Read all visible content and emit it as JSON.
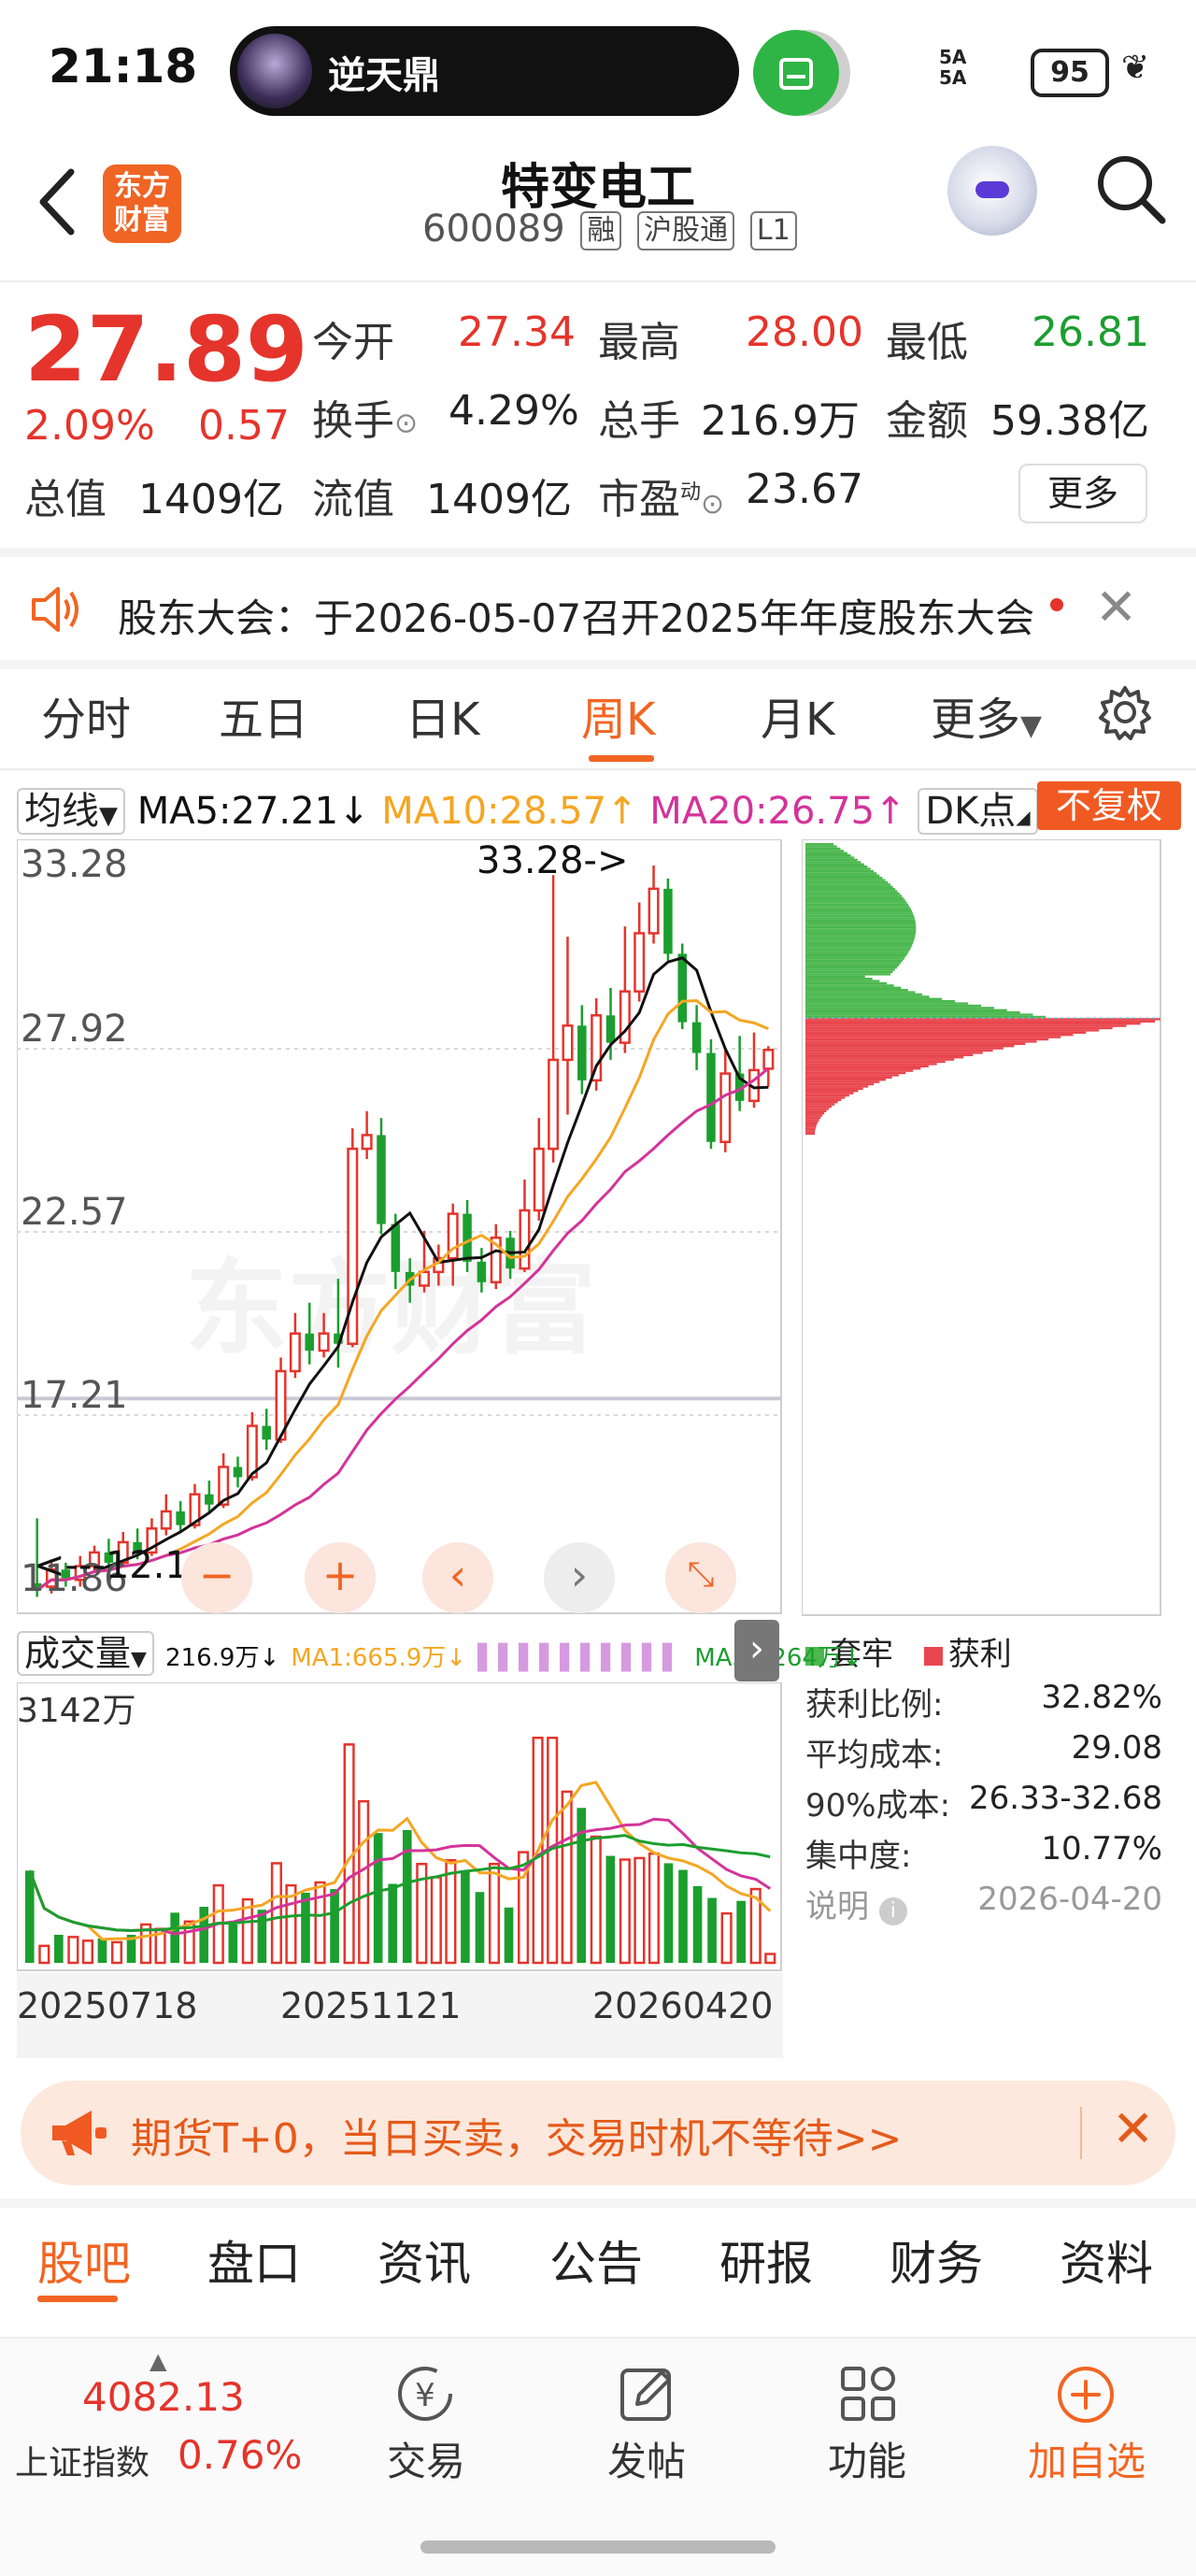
{
  "status_bar": {
    "time": "21:18",
    "pill_title": "逆天鼎",
    "signal_top": "5A",
    "signal_bottom": "5A",
    "battery": "95"
  },
  "header": {
    "logo_line1": "东方",
    "logo_line2": "财富",
    "stock_name": "特变电工",
    "stock_code": "600089",
    "tags": [
      "融",
      "沪股通",
      "L1"
    ]
  },
  "quote": {
    "price": "27.89",
    "change_pct": "2.09%",
    "change": "0.57",
    "open_label": "今开",
    "open": "27.34",
    "high_label": "最高",
    "high": "28.00",
    "low_label": "最低",
    "low": "26.81",
    "turnover_label": "换手",
    "turnover": "4.29%",
    "volume_label": "总手",
    "volume": "216.9万",
    "amount_label": "金额",
    "amount": "59.38亿",
    "total_mv_label": "总值",
    "total_mv": "1409亿",
    "float_mv_label": "流值",
    "float_mv": "1409亿",
    "pe_label": "市盈",
    "pe_sup": "动",
    "pe": "23.67",
    "more_label": "更多"
  },
  "notice": {
    "text": "股东大会：于2026-05-07召开2025年年度股东大会"
  },
  "period_tabs": [
    "分时",
    "五日",
    "日K",
    "周K",
    "月K",
    "更多"
  ],
  "active_tab": "周K",
  "ma_row": {
    "selector": "均线",
    "ma5": "MA5:27.21",
    "ma5_arrow": "↓",
    "ma10": "MA10:28.57",
    "ma10_arrow": "↑",
    "ma20": "MA20:26.75",
    "ma20_arrow": "↑",
    "dk": "DK点",
    "adjust": "不复权"
  },
  "colors": {
    "up": "#e5342b",
    "down": "#1c9e2f",
    "ma5": "#111111",
    "ma10": "#f5a623",
    "ma20": "#d4339a",
    "accent": "#f26522"
  },
  "kline": {
    "y_labels": [
      "33.28",
      "27.92",
      "22.57",
      "17.21",
      "11.86"
    ],
    "high_annotation": "33.28->",
    "low_annotation": "<---12.10"
  },
  "chart_data": {
    "type": "candlestick",
    "title": "",
    "period": "weekly",
    "ylim": [
      11.86,
      33.28
    ],
    "ylabels": [
      "33.28",
      "27.92",
      "22.57",
      "17.21",
      "11.86"
    ],
    "x_labels": [
      "20250718",
      "20251121",
      "20260420"
    ],
    "candles": [
      {
        "o": 12.3,
        "c": 12.1,
        "h": 14.2,
        "l": 11.9
      },
      {
        "o": 12.2,
        "c": 12.7,
        "h": 13.0,
        "l": 12.0
      },
      {
        "o": 12.7,
        "c": 12.4,
        "h": 12.9,
        "l": 12.2
      },
      {
        "o": 12.4,
        "c": 12.8,
        "h": 13.1,
        "l": 12.2
      },
      {
        "o": 12.8,
        "c": 13.2,
        "h": 13.4,
        "l": 12.6
      },
      {
        "o": 13.2,
        "c": 12.9,
        "h": 13.6,
        "l": 12.7
      },
      {
        "o": 12.9,
        "c": 13.5,
        "h": 13.8,
        "l": 12.8
      },
      {
        "o": 13.5,
        "c": 13.2,
        "h": 13.9,
        "l": 13.0
      },
      {
        "o": 13.2,
        "c": 13.9,
        "h": 14.2,
        "l": 13.1
      },
      {
        "o": 13.9,
        "c": 14.4,
        "h": 14.9,
        "l": 13.7
      },
      {
        "o": 14.4,
        "c": 14.0,
        "h": 14.7,
        "l": 13.8
      },
      {
        "o": 14.0,
        "c": 14.9,
        "h": 15.2,
        "l": 13.9
      },
      {
        "o": 14.9,
        "c": 14.6,
        "h": 15.3,
        "l": 14.4
      },
      {
        "o": 14.6,
        "c": 15.7,
        "h": 16.1,
        "l": 14.5
      },
      {
        "o": 15.7,
        "c": 15.4,
        "h": 16.0,
        "l": 15.1
      },
      {
        "o": 15.4,
        "c": 16.9,
        "h": 17.3,
        "l": 15.3
      },
      {
        "o": 16.9,
        "c": 16.5,
        "h": 17.4,
        "l": 16.2
      },
      {
        "o": 16.5,
        "c": 18.5,
        "h": 18.9,
        "l": 16.4
      },
      {
        "o": 18.5,
        "c": 19.6,
        "h": 20.2,
        "l": 18.3
      },
      {
        "o": 19.6,
        "c": 19.1,
        "h": 20.5,
        "l": 18.7
      },
      {
        "o": 19.1,
        "c": 19.6,
        "h": 20.2,
        "l": 18.9
      },
      {
        "o": 19.6,
        "c": 19.3,
        "h": 21.2,
        "l": 18.6
      },
      {
        "o": 19.3,
        "c": 25.0,
        "h": 25.6,
        "l": 19.2
      },
      {
        "o": 25.0,
        "c": 25.4,
        "h": 26.1,
        "l": 24.7
      },
      {
        "o": 25.4,
        "c": 22.8,
        "h": 25.9,
        "l": 22.5
      },
      {
        "o": 22.8,
        "c": 21.4,
        "h": 23.1,
        "l": 20.9
      },
      {
        "o": 21.4,
        "c": 21.0,
        "h": 21.8,
        "l": 20.5
      },
      {
        "o": 21.0,
        "c": 21.4,
        "h": 22.6,
        "l": 20.8
      },
      {
        "o": 21.4,
        "c": 21.8,
        "h": 22.2,
        "l": 21.0
      },
      {
        "o": 21.8,
        "c": 23.1,
        "h": 23.4,
        "l": 21.0
      },
      {
        "o": 23.1,
        "c": 21.7,
        "h": 23.5,
        "l": 21.4
      },
      {
        "o": 21.7,
        "c": 21.1,
        "h": 22.1,
        "l": 20.8
      },
      {
        "o": 21.1,
        "c": 22.4,
        "h": 22.8,
        "l": 20.9
      },
      {
        "o": 22.4,
        "c": 21.5,
        "h": 22.6,
        "l": 21.2
      },
      {
        "o": 21.5,
        "c": 23.2,
        "h": 24.1,
        "l": 21.4
      },
      {
        "o": 23.2,
        "c": 25.0,
        "h": 25.9,
        "l": 22.9
      },
      {
        "o": 25.0,
        "c": 27.6,
        "h": 33.0,
        "l": 24.6
      },
      {
        "o": 27.6,
        "c": 28.6,
        "h": 31.2,
        "l": 26.0
      },
      {
        "o": 28.6,
        "c": 27.0,
        "h": 29.2,
        "l": 26.6
      },
      {
        "o": 27.0,
        "c": 28.9,
        "h": 29.4,
        "l": 26.7
      },
      {
        "o": 28.9,
        "c": 28.1,
        "h": 29.7,
        "l": 27.6
      },
      {
        "o": 28.1,
        "c": 29.6,
        "h": 31.5,
        "l": 27.8
      },
      {
        "o": 29.6,
        "c": 31.3,
        "h": 32.2,
        "l": 29.3
      },
      {
        "o": 31.3,
        "c": 32.6,
        "h": 33.28,
        "l": 31.0
      },
      {
        "o": 32.6,
        "c": 30.7,
        "h": 32.9,
        "l": 30.5
      },
      {
        "o": 30.7,
        "c": 28.7,
        "h": 31.0,
        "l": 28.5
      },
      {
        "o": 28.7,
        "c": 27.8,
        "h": 29.2,
        "l": 27.3
      },
      {
        "o": 27.8,
        "c": 25.2,
        "h": 28.2,
        "l": 25.0
      },
      {
        "o": 25.2,
        "c": 27.2,
        "h": 27.9,
        "l": 24.9
      },
      {
        "o": 27.2,
        "c": 26.4,
        "h": 28.3,
        "l": 26.1
      },
      {
        "o": 26.4,
        "c": 27.3,
        "h": 28.4,
        "l": 26.2
      },
      {
        "o": 27.34,
        "c": 27.89,
        "h": 28.0,
        "l": 26.81
      }
    ],
    "volume": {
      "ylabel_max": "3142万",
      "ylim": [
        0,
        3142
      ],
      "values": [
        1250,
        230,
        380,
        350,
        300,
        330,
        280,
        380,
        520,
        460,
        680,
        560,
        760,
        1050,
        520,
        860,
        720,
        1350,
        1050,
        950,
        1090,
        1000,
        2960,
        2190,
        1760,
        1070,
        1800,
        1340,
        1160,
        1390,
        1250,
        960,
        1340,
        750,
        1500,
        3050,
        3050,
        2320,
        2100,
        1710,
        1450,
        1400,
        1420,
        1480,
        1350,
        1260,
        1040,
        880,
        670,
        840,
        1000,
        120
      ],
      "ma_series": [
        {
          "name": "MA1",
          "label": "MA1:665.9万",
          "arrow": "↓",
          "color": "#f5a623"
        },
        {
          "name": "MA2",
          "label": "",
          "arrow": "",
          "color": "#d4339a"
        },
        {
          "name": "MA3",
          "label": "MA3:1264万",
          "arrow": "↓",
          "color": "#1c9e2f"
        }
      ]
    }
  },
  "volume_row": {
    "selector": "成交量",
    "vol": "216.9万",
    "vol_arrow": "↓",
    "ma1": "MA1:665.9万",
    "ma1_arrow": "↓",
    "ma3": "MA3:1264万",
    "ma3_arrow": "↓"
  },
  "chip_panel": {
    "legend_trapped": "套牢",
    "legend_profit": "获利",
    "stats": [
      {
        "label": "获利比例:",
        "value": "32.82%"
      },
      {
        "label": "平均成本:",
        "value": "29.08"
      },
      {
        "label": "90%成本:",
        "value": "26.33-32.68"
      },
      {
        "label": "集中度:",
        "value": "10.77%"
      }
    ],
    "note_label": "说明",
    "note_date": "2026-04-20"
  },
  "ad": {
    "text": "期货T+0，当日买卖，交易时机不等待>>"
  },
  "section_tabs": [
    "股吧",
    "盘口",
    "资讯",
    "公告",
    "研报",
    "财务",
    "资料"
  ],
  "toolbar": {
    "index_value": "4082.13",
    "index_name": "上证指数",
    "index_pct": "0.76%",
    "trade": "交易",
    "post": "发帖",
    "func": "功能",
    "add": "加自选"
  }
}
